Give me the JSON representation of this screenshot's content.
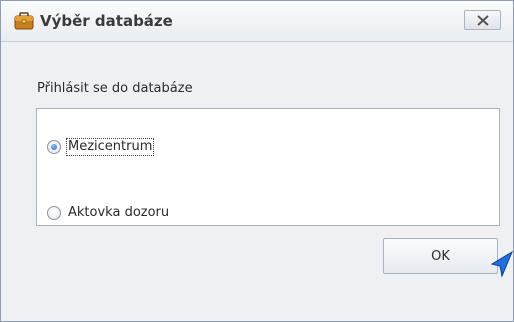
{
  "window": {
    "title": "Výběr databáze",
    "icon": "briefcase-icon",
    "close_icon": "close-x-icon"
  },
  "group": {
    "label": "Přihlásit se do databáze"
  },
  "options": [
    {
      "label": "Mezicentrum",
      "checked": true,
      "focused": true
    },
    {
      "label": "Aktovka dozoru",
      "checked": false,
      "focused": false
    }
  ],
  "buttons": {
    "ok_label": "OK"
  },
  "colors": {
    "accent": "#2563c7",
    "border": "#a9b3c1",
    "cursor": "#1f6fe0"
  }
}
